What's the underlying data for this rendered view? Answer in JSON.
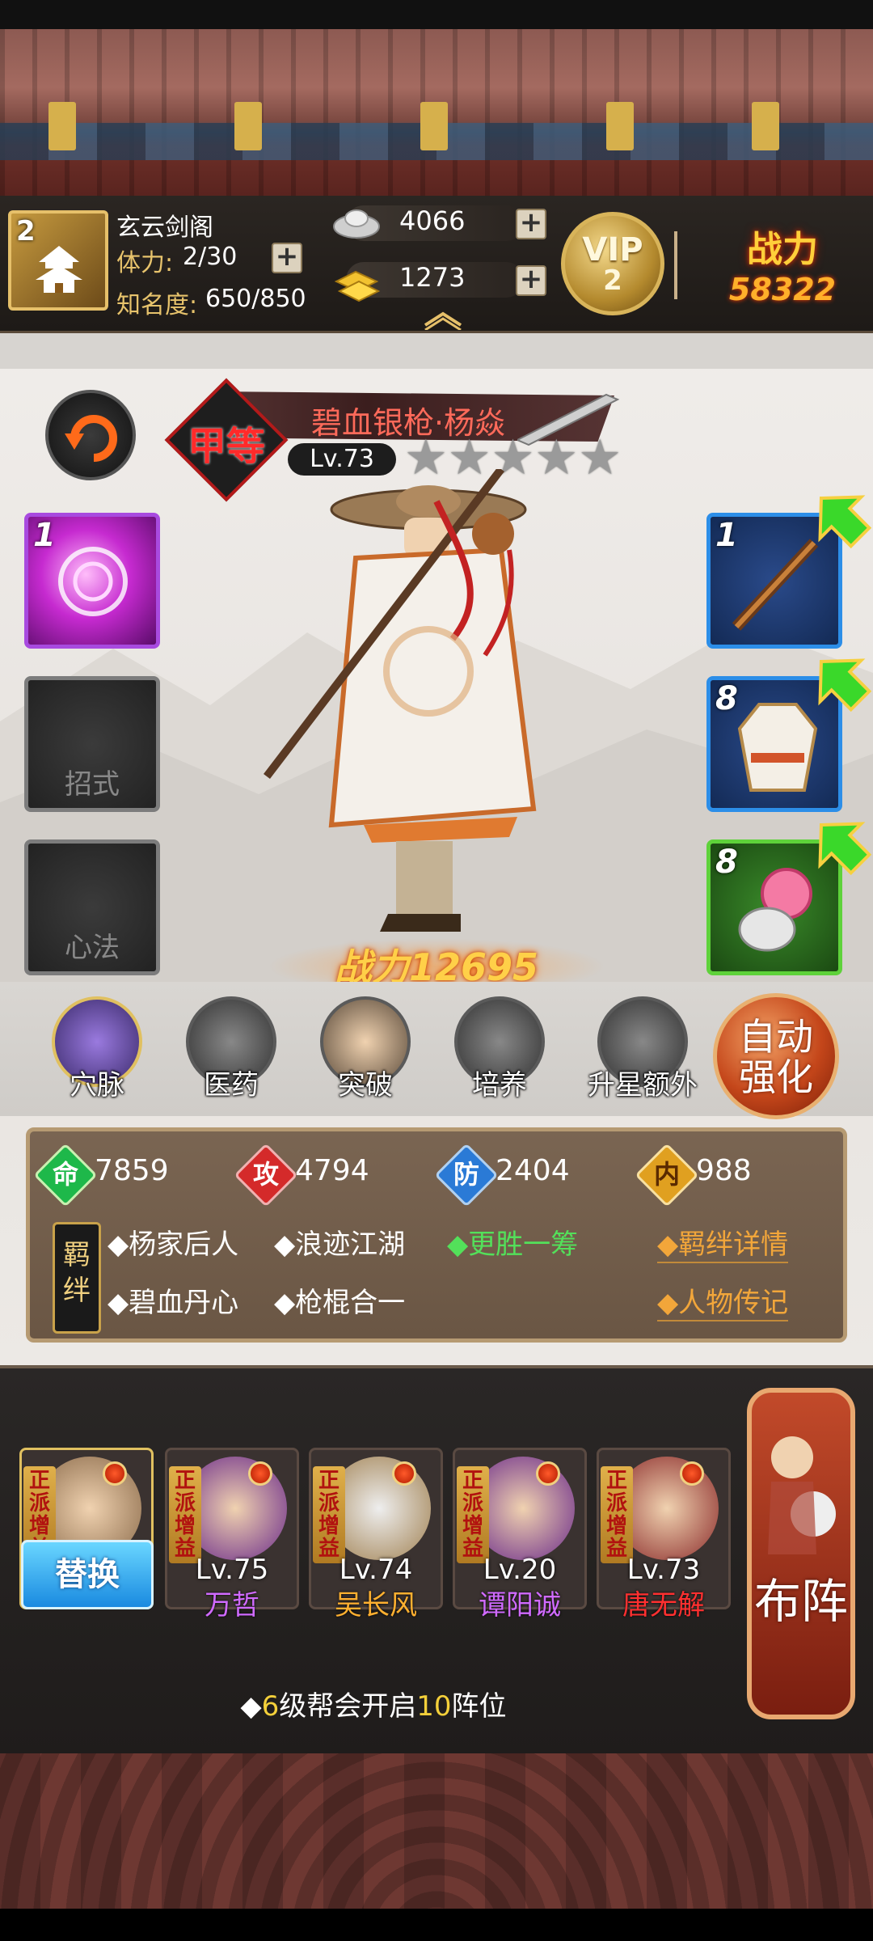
{
  "header": {
    "guild_level": "2",
    "guild_name": "玄云剑阁",
    "stamina_label": "体力:",
    "stamina_value": "2/30",
    "fame_label": "知名度:",
    "fame_value": "650/850",
    "silver": "4066",
    "gold": "1273",
    "vip_label": "VIP",
    "vip_level": "2",
    "power_label": "战力",
    "power_value": "58322"
  },
  "hero": {
    "grade": "甲等",
    "name": "碧血银枪·杨焱",
    "level": "Lv.73",
    "stars_total": 5,
    "stars_filled": 0,
    "power": "战力12695"
  },
  "left_slots": [
    {
      "num": "1",
      "label": ""
    },
    {
      "num": "",
      "label": "招式"
    },
    {
      "num": "",
      "label": "心法"
    }
  ],
  "right_slots": [
    {
      "num": "1",
      "item": "spear-icon"
    },
    {
      "num": "8",
      "item": "robe-icon"
    },
    {
      "num": "8",
      "item": "flower-pouch-icon"
    }
  ],
  "actions": [
    {
      "label": "穴脉",
      "icon": "meridian-icon"
    },
    {
      "label": "医药",
      "icon": "herb-icon"
    },
    {
      "label": "突破",
      "icon": "breakthrough-icon"
    },
    {
      "label": "培养",
      "icon": "scroll-icon"
    },
    {
      "label": "升星额外",
      "icon": "star-up-icon"
    }
  ],
  "auto_enhance": {
    "line1": "自动",
    "line2": "强化"
  },
  "stats": [
    {
      "char": "命",
      "value": "7859",
      "color": "#1eb84a"
    },
    {
      "char": "攻",
      "value": "4794",
      "color": "#d42a2a"
    },
    {
      "char": "防",
      "value": "2404",
      "color": "#2a7ad6"
    },
    {
      "char": "内",
      "value": "988",
      "color": "#e0a020"
    }
  ],
  "bonds": {
    "badge": "羁绊",
    "row1": [
      "◆杨家后人",
      "◆浪迹江湖",
      "◆更胜一筹"
    ],
    "row2": [
      "◆碧血丹心",
      "◆枪棍合一"
    ],
    "link1": "◆羁绊详情",
    "link2": "◆人物传记"
  },
  "lineup": {
    "tag": "正派增益",
    "replace_label": "替换",
    "heroes": [
      {
        "level": "",
        "name": "",
        "name_color": "#ffffff"
      },
      {
        "level": "Lv.75",
        "name": "万哲",
        "name_color": "#d06aff"
      },
      {
        "level": "Lv.74",
        "name": "吴长风",
        "name_color": "#ffb030"
      },
      {
        "level": "Lv.20",
        "name": "谭阳诚",
        "name_color": "#d06aff"
      },
      {
        "level": "Lv.73",
        "name": "唐无解",
        "name_color": "#ff3030"
      }
    ],
    "formation_label": "布阵",
    "notice_prefix": "◆",
    "notice_num1": "6",
    "notice_mid": "级帮会开启",
    "notice_num2": "10",
    "notice_suffix": "阵位"
  }
}
